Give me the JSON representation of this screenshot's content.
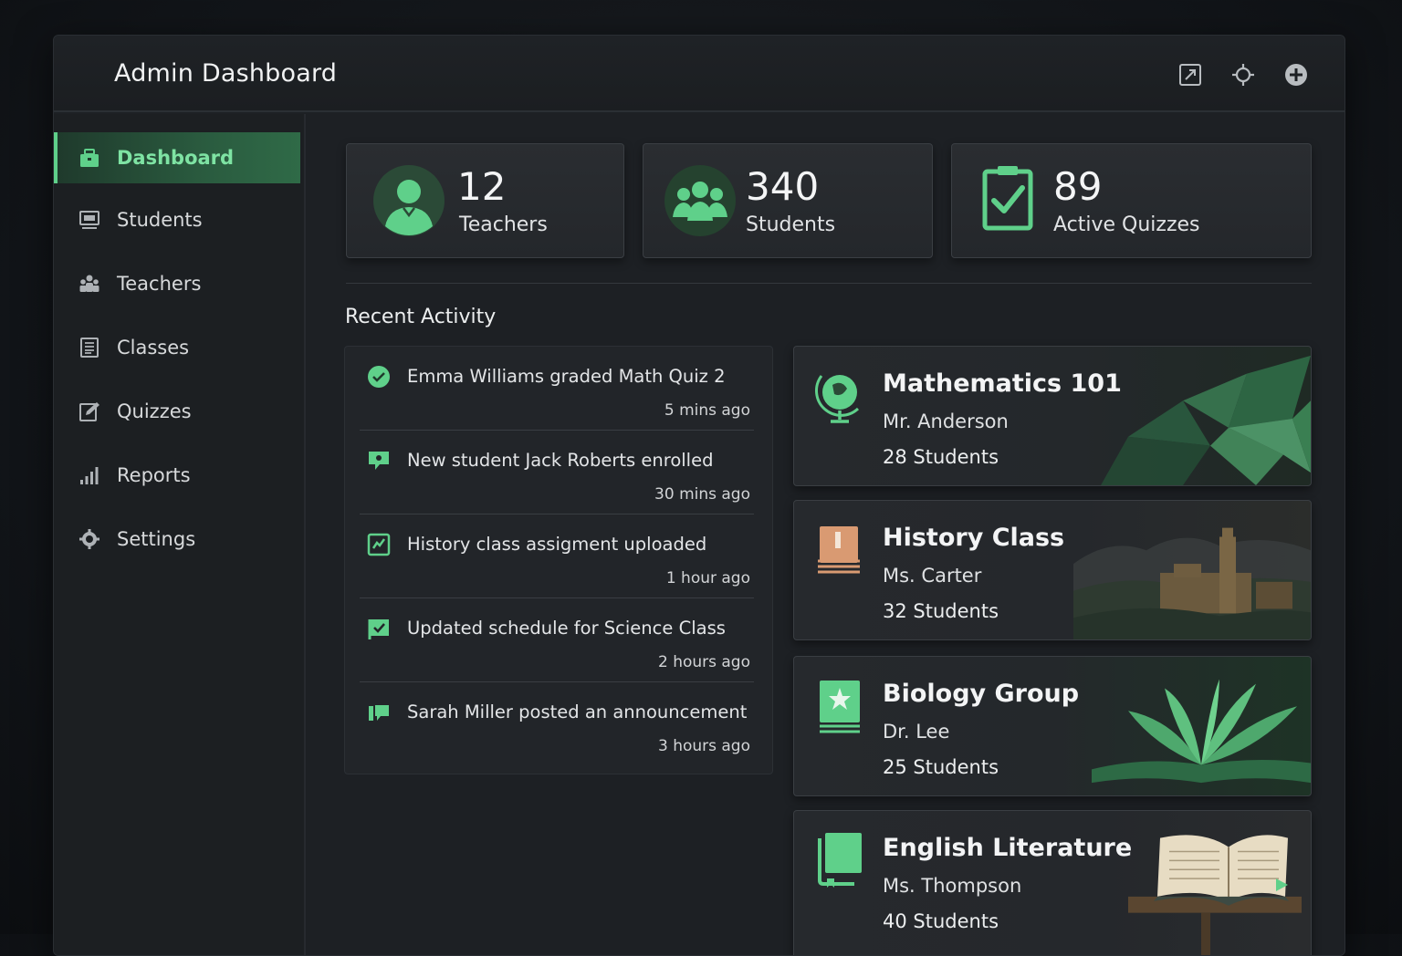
{
  "app": {
    "title": "Admin Dashboard"
  },
  "topbar": {
    "icons": [
      "expand-icon",
      "settings-gear-icon",
      "add-circle-icon"
    ]
  },
  "sidebar": {
    "items": [
      {
        "label": "Dashboard",
        "icon": "briefcase-icon",
        "active": true
      },
      {
        "label": "Students",
        "icon": "monitor-icon"
      },
      {
        "label": "Teachers",
        "icon": "people-icon"
      },
      {
        "label": "Classes",
        "icon": "document-list-icon"
      },
      {
        "label": "Quizzes",
        "icon": "edit-icon"
      },
      {
        "label": "Reports",
        "icon": "bar-chart-icon"
      },
      {
        "label": "Settings",
        "icon": "gear-icon"
      }
    ]
  },
  "stats": [
    {
      "value": "12",
      "label": "Teachers",
      "icon": "teacher-avatar-icon"
    },
    {
      "value": "340",
      "label": "Students",
      "icon": "students-group-icon"
    },
    {
      "value": "89",
      "label": "Active Quizzes",
      "icon": "clipboard-check-icon"
    }
  ],
  "activity": {
    "title": "Recent Activity",
    "items": [
      {
        "text": "Emma Williams graded Math Quiz 2",
        "time": "5 mins ago",
        "icon": "check-circle-icon"
      },
      {
        "text": "New student Jack Roberts enrolled",
        "time": "30 mins ago",
        "icon": "chat-bubble-icon"
      },
      {
        "text": "History class assigment uploaded",
        "time": "1 hour ago",
        "icon": "upload-box-icon"
      },
      {
        "text": "Updated schedule for Science Class",
        "time": "2 hours ago",
        "icon": "checked-flag-icon"
      },
      {
        "text": "Sarah Miller posted an announcement",
        "time": "3 hours ago",
        "icon": "announcement-icon"
      }
    ]
  },
  "courses": [
    {
      "name": "Mathematics 101",
      "teacher": "Mr. Anderson",
      "students": "28 Students",
      "icon": "globe-icon"
    },
    {
      "name": "History Class",
      "teacher": "Ms. Carter",
      "students": "32 Students",
      "icon": "book-stack-icon"
    },
    {
      "name": "Biology Group",
      "teacher": "Dr. Lee",
      "students": "25 Students",
      "icon": "star-book-icon"
    },
    {
      "name": "English Literature",
      "teacher": "Ms. Thompson",
      "students": "40 Students",
      "icon": "books-icon"
    }
  ],
  "colors": {
    "accent": "#5fd08a",
    "background": "#1d2024",
    "card": "#25282c",
    "text": "#e6e8ea"
  }
}
